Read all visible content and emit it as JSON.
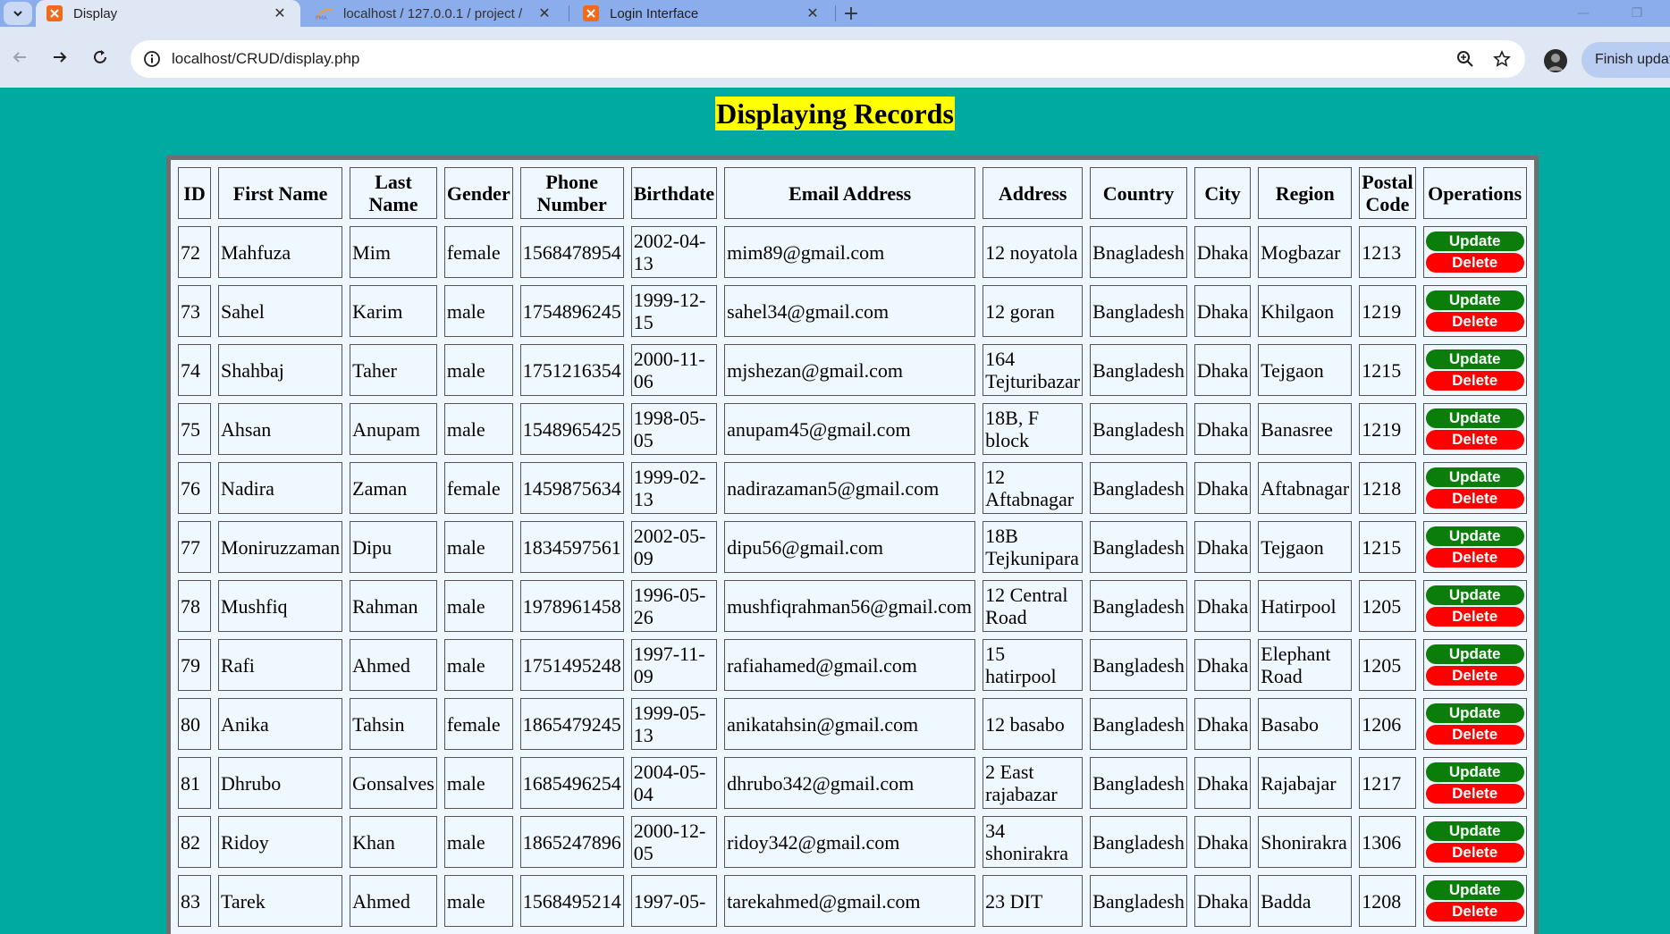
{
  "browser": {
    "tabs": [
      {
        "label": "Display",
        "active": true
      },
      {
        "label": "localhost / 127.0.0.1 / project / ",
        "active": false
      },
      {
        "label": "Login Interface",
        "active": false
      }
    ],
    "url": "localhost/CRUD/display.php",
    "finish_update_label": "Finish update"
  },
  "page": {
    "heading": "Displaying Records",
    "columns": [
      "ID",
      "First Name",
      "Last Name",
      "Gender",
      "Phone Number",
      "Birthdate",
      "Email Address",
      "Address",
      "Country",
      "City",
      "Region",
      "Postal Code",
      "Operations"
    ],
    "update_label": "Update",
    "delete_label": "Delete",
    "rows": [
      {
        "id": "72",
        "first": "Mahfuza",
        "last": "Mim",
        "gender": "female",
        "phone": "1568478954",
        "birthdate": "2002-04-13",
        "email": "mim89@gmail.com",
        "address": "12 noyatola",
        "country": "Bnagladesh",
        "city": "Dhaka",
        "region": "Mogbazar",
        "postal": "1213"
      },
      {
        "id": "73",
        "first": "Sahel",
        "last": "Karim",
        "gender": "male",
        "phone": "1754896245",
        "birthdate": "1999-12-15",
        "email": "sahel34@gmail.com",
        "address": "12 goran",
        "country": "Bangladesh",
        "city": "Dhaka",
        "region": "Khilgaon",
        "postal": "1219"
      },
      {
        "id": "74",
        "first": "Shahbaj",
        "last": "Taher",
        "gender": "male",
        "phone": "1751216354",
        "birthdate": "2000-11-06",
        "email": "mjshezan@gmail.com",
        "address": "164 Tejturibazar",
        "country": "Bangladesh",
        "city": "Dhaka",
        "region": "Tejgaon",
        "postal": "1215"
      },
      {
        "id": "75",
        "first": "Ahsan",
        "last": "Anupam",
        "gender": "male",
        "phone": "1548965425",
        "birthdate": "1998-05-05",
        "email": "anupam45@gmail.com",
        "address": "18B, F block",
        "country": "Bangladesh",
        "city": "Dhaka",
        "region": "Banasree",
        "postal": "1219"
      },
      {
        "id": "76",
        "first": "Nadira",
        "last": "Zaman",
        "gender": "female",
        "phone": "1459875634",
        "birthdate": "1999-02-13",
        "email": "nadirazaman5@gmail.com",
        "address": "12 Aftabnagar",
        "country": "Bangladesh",
        "city": "Dhaka",
        "region": "Aftabnagar",
        "postal": "1218"
      },
      {
        "id": "77",
        "first": "Moniruzzaman",
        "last": "Dipu",
        "gender": "male",
        "phone": "1834597561",
        "birthdate": "2002-05-09",
        "email": "dipu56@gmail.com",
        "address": "18B Tejkunipara",
        "country": "Bangladesh",
        "city": "Dhaka",
        "region": "Tejgaon",
        "postal": "1215"
      },
      {
        "id": "78",
        "first": "Mushfiq",
        "last": "Rahman",
        "gender": "male",
        "phone": "1978961458",
        "birthdate": "1996-05-26",
        "email": "mushfiqrahman56@gmail.com",
        "address": "12 Central Road",
        "country": "Bangladesh",
        "city": "Dhaka",
        "region": "Hatirpool",
        "postal": "1205"
      },
      {
        "id": "79",
        "first": "Rafi",
        "last": "Ahmed",
        "gender": "male",
        "phone": "1751495248",
        "birthdate": "1997-11-09",
        "email": "rafiahamed@gmail.com",
        "address": "15 hatirpool",
        "country": "Bangladesh",
        "city": "Dhaka",
        "region": "Elephant Road",
        "postal": "1205"
      },
      {
        "id": "80",
        "first": "Anika",
        "last": "Tahsin",
        "gender": "female",
        "phone": "1865479245",
        "birthdate": "1999-05-13",
        "email": "anikatahsin@gmail.com",
        "address": "12 basabo",
        "country": "Bangladesh",
        "city": "Dhaka",
        "region": "Basabo",
        "postal": "1206"
      },
      {
        "id": "81",
        "first": "Dhrubo",
        "last": "Gonsalves",
        "gender": "male",
        "phone": "1685496254",
        "birthdate": "2004-05-04",
        "email": "dhrubo342@gmail.com",
        "address": "2 East rajabazar",
        "country": "Bangladesh",
        "city": "Dhaka",
        "region": "Rajabajar",
        "postal": "1217"
      },
      {
        "id": "82",
        "first": "Ridoy",
        "last": "Khan",
        "gender": "male",
        "phone": "1865247896",
        "birthdate": "2000-12-05",
        "email": "ridoy342@gmail.com",
        "address": "34 shonirakra",
        "country": "Bangladesh",
        "city": "Dhaka",
        "region": "Shonirakra",
        "postal": "1306"
      },
      {
        "id": "83",
        "first": "Tarek",
        "last": "Ahmed",
        "gender": "male",
        "phone": "1568495214",
        "birthdate": "1997-05-",
        "email": "tarekahmed@gmail.com",
        "address": "23 DIT",
        "country": "Bangladesh",
        "city": "Dhaka",
        "region": "Badda",
        "postal": "1208"
      }
    ]
  }
}
